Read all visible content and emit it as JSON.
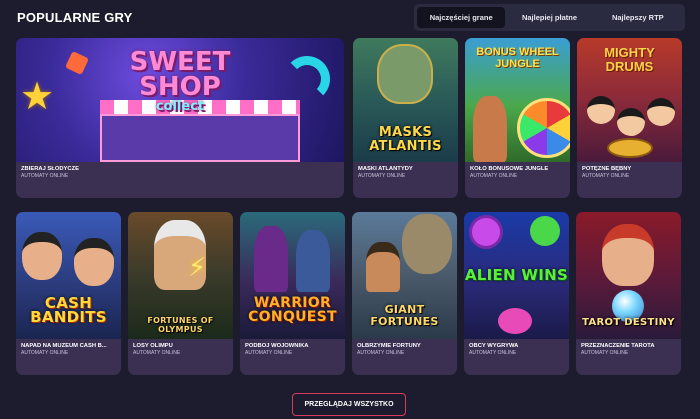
{
  "section": {
    "title": "POPULARNE GRY"
  },
  "tabs": [
    {
      "label": "Najczęściej grane",
      "active": true
    },
    {
      "label": "Najlepiej płatne",
      "active": false
    },
    {
      "label": "Najlepszy RTP",
      "active": false
    }
  ],
  "featured": {
    "logo_line1": "SWEET",
    "logo_line2": "SHOP",
    "logo_line3": "collect",
    "name": "ZBIERAJ SŁODYCZE",
    "category": "AUTOMATY ONLINE"
  },
  "games_row1": [
    {
      "logo": "MASKS ATLANTIS",
      "name": "MASKI ATLANTYDY",
      "category": "AUTOMATY ONLINE"
    },
    {
      "logo": "BONUS WHEEL JUNGLE",
      "name": "KOŁO BONUSOWE JUNGLE",
      "category": "AUTOMATY ONLINE"
    },
    {
      "logo": "MIGHTY DRUMS",
      "name": "POTĘŻNE BĘBNY",
      "category": "AUTOMATY ONLINE"
    }
  ],
  "games_row2": [
    {
      "logo": "CASH BANDITS",
      "name": "NAPAD NA MUZEUM CASH B...",
      "category": "AUTOMATY ONLINE"
    },
    {
      "logo": "FORTUNES OF OLYMPUS",
      "name": "LOSY OLIMPU",
      "category": "AUTOMATY ONLINE"
    },
    {
      "logo": "WARRIOR CONQUEST",
      "name": "PODBÓJ WOJOWNIKA",
      "category": "AUTOMATY ONLINE"
    },
    {
      "logo": "GIANT FORTUNES",
      "name": "OLBRZYMIE FORTUNY",
      "category": "AUTOMATY ONLINE"
    },
    {
      "logo": "ALIEN WINS",
      "name": "OBCY WYGRYWA",
      "category": "AUTOMATY ONLINE"
    },
    {
      "logo": "TAROT DESTINY",
      "name": "PRZEZNACZENIE TAROTA",
      "category": "AUTOMATY ONLINE"
    }
  ],
  "footer": {
    "view_all_label": "PRZEGLĄDAJ WSZYSTKO"
  },
  "colors": {
    "background": "#1d1c2e",
    "card_info": "#3b2f52",
    "accent_border": "#d83a5a"
  }
}
